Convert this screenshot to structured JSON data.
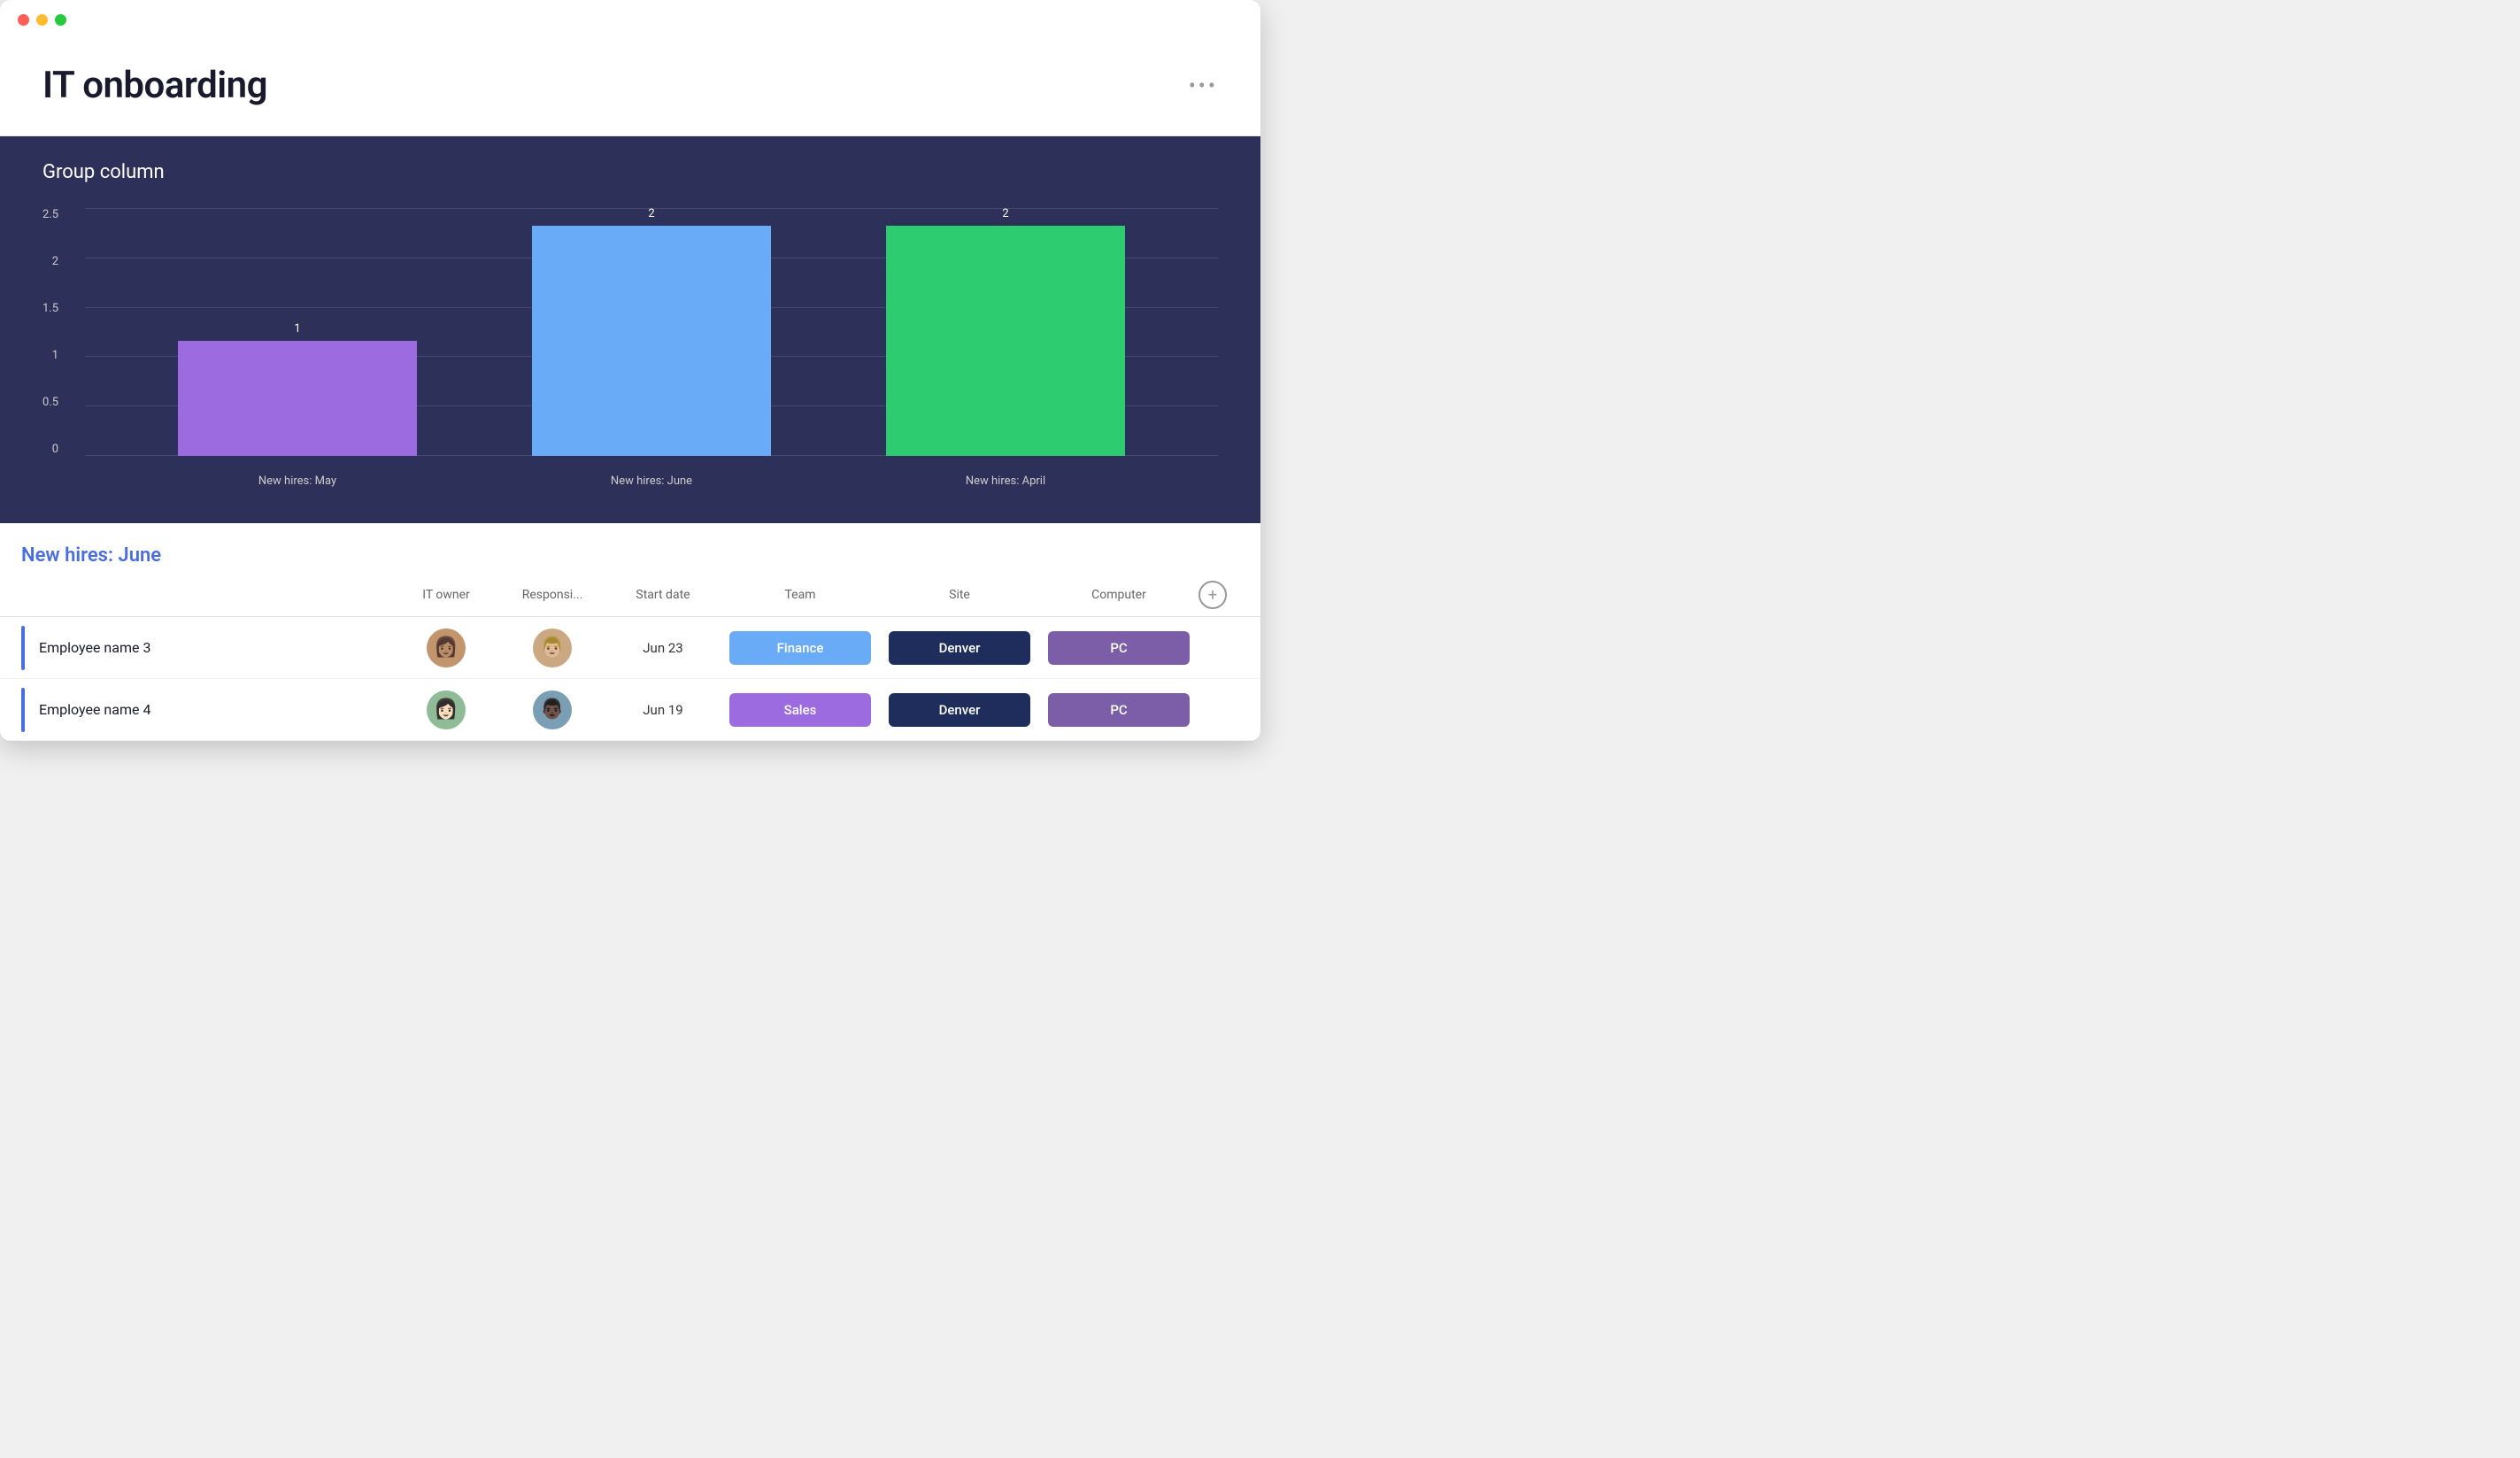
{
  "window": {
    "dots": [
      "red",
      "yellow",
      "green"
    ]
  },
  "header": {
    "title": "IT onboarding",
    "more_label": "•••"
  },
  "chart": {
    "section_title": "Group column",
    "y_labels": [
      "2.5",
      "2",
      "1.5",
      "1",
      "0.5",
      "0"
    ],
    "bars": [
      {
        "label": "New hires: May",
        "value": 1,
        "color": "#9c6bdf",
        "height_pct": 40
      },
      {
        "label": "New hires: June",
        "value": 2,
        "color": "#6aabf7",
        "height_pct": 80
      },
      {
        "label": "New hires: April",
        "value": 2,
        "color": "#2ecc71",
        "height_pct": 80
      }
    ]
  },
  "table": {
    "group_label": "New hires: June",
    "columns": {
      "name": "",
      "owner": "IT owner",
      "responsible": "Responsi...",
      "startdate": "Start date",
      "team": "Team",
      "site": "Site",
      "computer": "Computer"
    },
    "rows": [
      {
        "name": "Employee name 3",
        "startdate": "Jun 23",
        "team": "Finance",
        "team_color": "#6aabf7",
        "site": "Denver",
        "site_color": "#1f2d5c",
        "computer": "PC",
        "computer_color": "#7b5ea7"
      },
      {
        "name": "Employee name 4",
        "startdate": "Jun 19",
        "team": "Sales",
        "team_color": "#9c6bdf",
        "site": "Denver",
        "site_color": "#1f2d5c",
        "computer": "PC",
        "computer_color": "#7b5ea7"
      }
    ],
    "add_icon": "+"
  }
}
